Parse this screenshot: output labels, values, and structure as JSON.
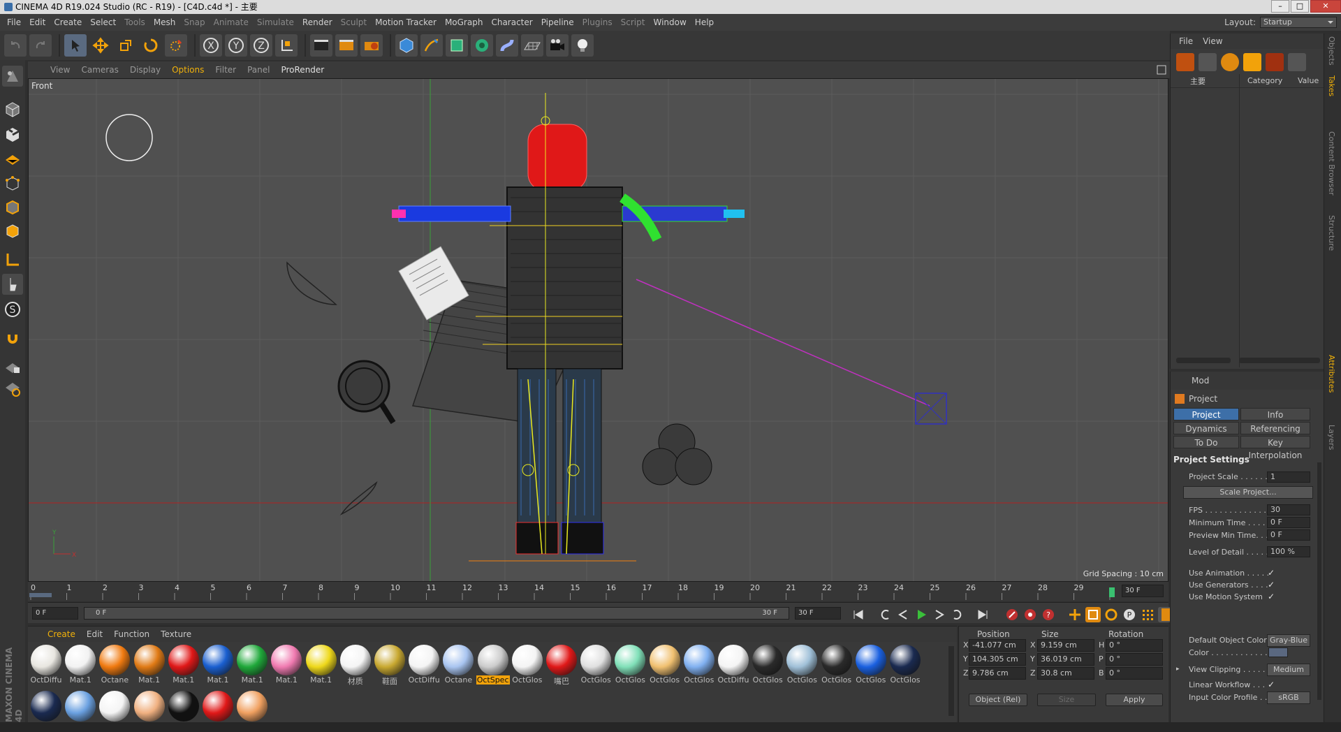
{
  "window": {
    "title": "CINEMA 4D R19.024 Studio (RC - R19) - [C4D.c4d *] - 主要"
  },
  "menu": [
    {
      "label": "File",
      "dim": false
    },
    {
      "label": "Edit",
      "dim": false
    },
    {
      "label": "Create",
      "dim": false
    },
    {
      "label": "Select",
      "dim": false
    },
    {
      "label": "Tools",
      "dim": true
    },
    {
      "label": "Mesh",
      "dim": false
    },
    {
      "label": "Snap",
      "dim": true
    },
    {
      "label": "Animate",
      "dim": true
    },
    {
      "label": "Simulate",
      "dim": true
    },
    {
      "label": "Render",
      "dim": false
    },
    {
      "label": "Sculpt",
      "dim": true
    },
    {
      "label": "Motion Tracker",
      "dim": false
    },
    {
      "label": "MoGraph",
      "dim": false
    },
    {
      "label": "Character",
      "dim": false
    },
    {
      "label": "Pipeline",
      "dim": false
    },
    {
      "label": "Plugins",
      "dim": true
    },
    {
      "label": "Script",
      "dim": true
    },
    {
      "label": "Window",
      "dim": false
    },
    {
      "label": "Help",
      "dim": false
    }
  ],
  "layout": {
    "label": "Layout:",
    "value": "Startup"
  },
  "viewport": {
    "menu": [
      "View",
      "Cameras",
      "Display",
      "Options",
      "Filter",
      "Panel",
      "ProRender"
    ],
    "active_menu": "Options",
    "name": "Front",
    "grid_spacing": "Grid Spacing : 10 cm",
    "axis_y": "Y",
    "axis_x": "X"
  },
  "timeline": {
    "ticks": [
      "0",
      "1",
      "2",
      "3",
      "4",
      "5",
      "6",
      "7",
      "8",
      "9",
      "10",
      "11",
      "12",
      "13",
      "14",
      "15",
      "16",
      "17",
      "18",
      "19",
      "20",
      "21",
      "22",
      "23",
      "24",
      "25",
      "26",
      "27",
      "28",
      "29"
    ],
    "end_field": "30 F"
  },
  "transport": {
    "current": "0 F",
    "range_start": "0 F",
    "range_end": "30 F",
    "max": "30 F"
  },
  "material_manager": {
    "menu": [
      "Create",
      "Edit",
      "Function",
      "Texture"
    ],
    "materials": [
      {
        "label": "OctDiffu",
        "color": "#e8e6e0"
      },
      {
        "label": "Mat.1",
        "color": "#f2f2f2"
      },
      {
        "label": "Octane",
        "color": "#f07a10"
      },
      {
        "label": "Mat.1",
        "color": "#e07a15"
      },
      {
        "label": "Mat.1",
        "color": "#e01818"
      },
      {
        "label": "Mat.1",
        "color": "#1a5fd0"
      },
      {
        "label": "Mat.1",
        "color": "#1fa83a"
      },
      {
        "label": "Mat.1",
        "color": "#f07ab0"
      },
      {
        "label": "Mat.1",
        "color": "#eed81a"
      },
      {
        "label": "材质",
        "color": "#f4f4f4"
      },
      {
        "label": "鞋面",
        "color": "#c8a830"
      },
      {
        "label": "OctDiffu",
        "color": "#f4f4f4"
      },
      {
        "label": "Octane",
        "color": "#a8c4f0"
      },
      {
        "label": "OctSpec",
        "color": "#cccccc"
      },
      {
        "label": "OctGlos",
        "color": "#f4f4f4"
      },
      {
        "label": "嘴巴",
        "color": "#e01818"
      },
      {
        "label": "OctGlos",
        "color": "#e0e0e0"
      },
      {
        "label": "OctGlos",
        "color": "#80e0b8"
      },
      {
        "label": "OctGlos",
        "color": "#f0c070"
      },
      {
        "label": "OctGlos",
        "color": "#80b0f0"
      },
      {
        "label": "OctDiffu",
        "color": "#f4f4f4"
      },
      {
        "label": "OctGlos",
        "color": "#2a2a2a"
      },
      {
        "label": "OctGlos",
        "color": "#a0c0d8"
      },
      {
        "label": "OctGlos",
        "color": "#2a2a2a"
      },
      {
        "label": "OctGlos",
        "color": "#1a60e0"
      },
      {
        "label": "OctGlos",
        "color": "#1a2a50"
      }
    ],
    "row2": [
      {
        "color": "#1a2a50"
      },
      {
        "color": "#6aa0e0"
      },
      {
        "color": "#f4f4f4"
      },
      {
        "color": "#f0b080"
      },
      {
        "color": "#111111"
      },
      {
        "color": "#e01818"
      },
      {
        "color": "#f0a060"
      }
    ],
    "selected_index": 13
  },
  "coords": {
    "headers": {
      "position": "Position",
      "size": "Size",
      "rotation": "Rotation"
    },
    "rows": [
      {
        "axis": "X",
        "pos": "-41.077 cm",
        "saxis": "X",
        "size": "9.159 cm",
        "raxis": "H",
        "rot": "0 °"
      },
      {
        "axis": "Y",
        "pos": "104.305 cm",
        "saxis": "Y",
        "size": "36.019 cm",
        "raxis": "P",
        "rot": "0 °"
      },
      {
        "axis": "Z",
        "pos": "9.786 cm",
        "saxis": "Z",
        "size": "30.8 cm",
        "raxis": "B",
        "rot": "0 °"
      }
    ],
    "mode": "Object (Rel)",
    "size_mode": "Size",
    "apply": "Apply"
  },
  "object_manager": {
    "menu": [
      "File",
      "View"
    ],
    "col_name": "主要",
    "col_category": "Category",
    "col_value": "Value"
  },
  "attributes": {
    "mode": "Mod",
    "title": "Project",
    "tabs": [
      "Project Settings",
      "Info",
      "Dynamics",
      "Referencing",
      "To Do",
      "Key Interpolation"
    ],
    "section": "Project Settings",
    "scale_label": "Project Scale . . . . . .",
    "scale_value": "1",
    "scale_button": "Scale Project...",
    "fields": [
      {
        "label": "FPS . . . . . . . . . . . . . .",
        "value": "30"
      },
      {
        "label": "Minimum Time . . . . .",
        "value": "0 F"
      },
      {
        "label": "Preview Min Time. . .",
        "value": "0 F"
      },
      {
        "label": "Level of Detail . . . . .",
        "value": "100 %"
      }
    ],
    "checks": [
      {
        "label": "Use Animation . . . . .",
        "value": "✓"
      },
      {
        "label": "Use Generators . . . .",
        "value": "✓"
      },
      {
        "label": "Use Motion System",
        "value": "✓"
      }
    ],
    "default_color_label": "Default Object Color",
    "default_color_value": "Gray-Blue",
    "color_label": "Color . . . . . . . . . . . . .",
    "clipping_label": "View Clipping . . . . . .",
    "clipping_value": "Medium",
    "linear_label": "Linear Workflow . . .",
    "linear_value": "✓",
    "profile_label": "Input Color Profile . .",
    "profile_value": "sRGB"
  },
  "side_tabs": [
    "Objects",
    "Takes",
    "Content Browser",
    "Structure",
    "Attributes",
    "Layers"
  ],
  "brand": "MAXON CINEMA 4D",
  "colors": {
    "accent": "#f2b20a",
    "selection": "#3d6fa8",
    "viewport_bg": "#505050"
  }
}
